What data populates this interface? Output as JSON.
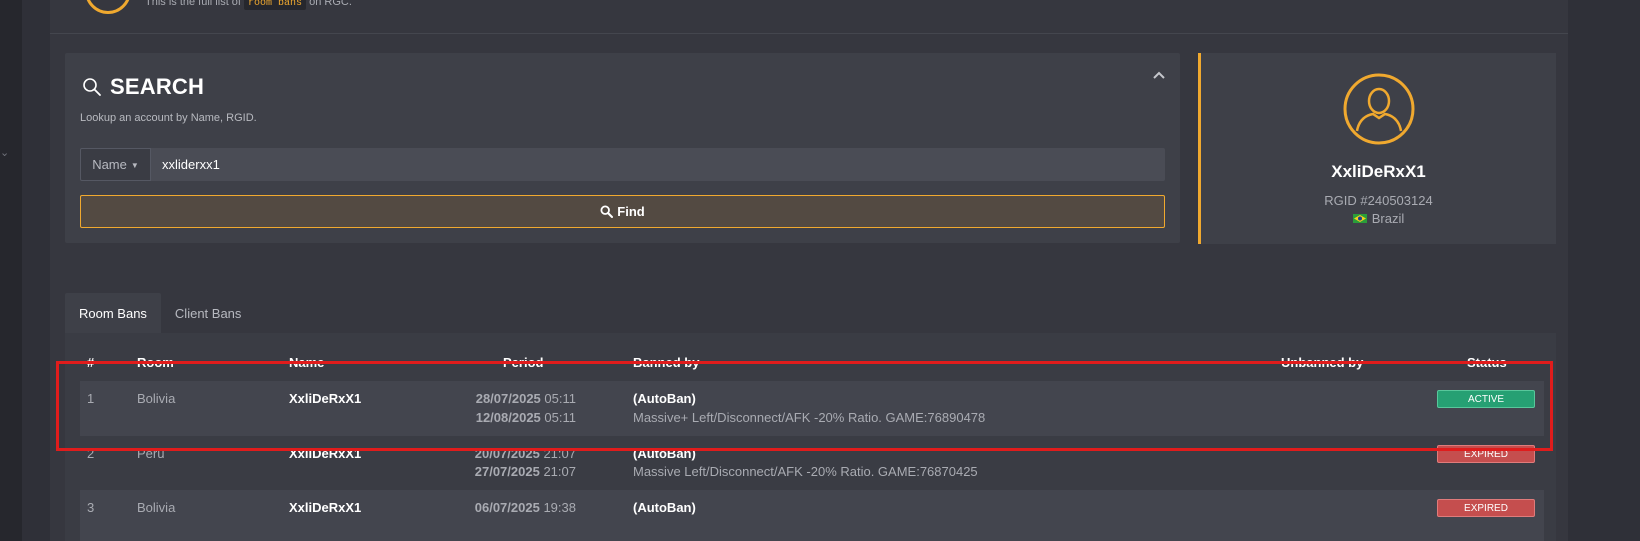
{
  "header": {
    "subtitle_prefix": "This is the full list of",
    "subtitle_code": "room bans",
    "subtitle_suffix": "on RGC."
  },
  "search": {
    "title": "SEARCH",
    "description": "Lookup an account by Name, RGID.",
    "filter_label": "Name",
    "input_value": "xxliderxx1",
    "find_label": "Find"
  },
  "profile": {
    "name": "XxliDeRxX1",
    "rgid": "RGID #240503124",
    "country": "Brazil"
  },
  "tabs": [
    {
      "label": "Room Bans",
      "active": true
    },
    {
      "label": "Client Bans",
      "active": false
    }
  ],
  "table": {
    "headers": [
      "#",
      "Room",
      "Name",
      "Period",
      "Banned by",
      "Unbanned by",
      "Status"
    ],
    "rows": [
      {
        "num": "1",
        "room": "Bolivia",
        "name": "XxliDeRxX1",
        "start_date": "28/07/2025",
        "start_time": "05:11",
        "end_date": "12/08/2025",
        "end_time": "05:11",
        "banned_by": "(AutoBan)",
        "reason": "Massive+ Left/Disconnect/AFK -20% Ratio. GAME:76890478",
        "unbanned_by": "",
        "status": "ACTIVE"
      },
      {
        "num": "2",
        "room": "Perú",
        "name": "XxliDeRxX1",
        "start_date": "20/07/2025",
        "start_time": "21:07",
        "end_date": "27/07/2025",
        "end_time": "21:07",
        "banned_by": "(AutoBan)",
        "reason": "Massive Left/Disconnect/AFK -20% Ratio. GAME:76870425",
        "unbanned_by": "",
        "status": "EXPIRED"
      },
      {
        "num": "3",
        "room": "Bolivia",
        "name": "XxliDeRxX1",
        "start_date": "06/07/2025",
        "start_time": "19:38",
        "end_date": "",
        "end_time": "",
        "banned_by": "(AutoBan)",
        "reason": "",
        "unbanned_by": "",
        "status": "EXPIRED"
      }
    ]
  },
  "colors": {
    "accent": "#f0a92f",
    "active_badge": "#26a073",
    "expired_badge": "#c54e4e",
    "highlight_box": "#e01c1c"
  },
  "icons": {
    "search": "search-icon",
    "collapse": "chevron-up-icon",
    "avatar": "user-avatar-icon",
    "flag": "brazil-flag-icon"
  }
}
